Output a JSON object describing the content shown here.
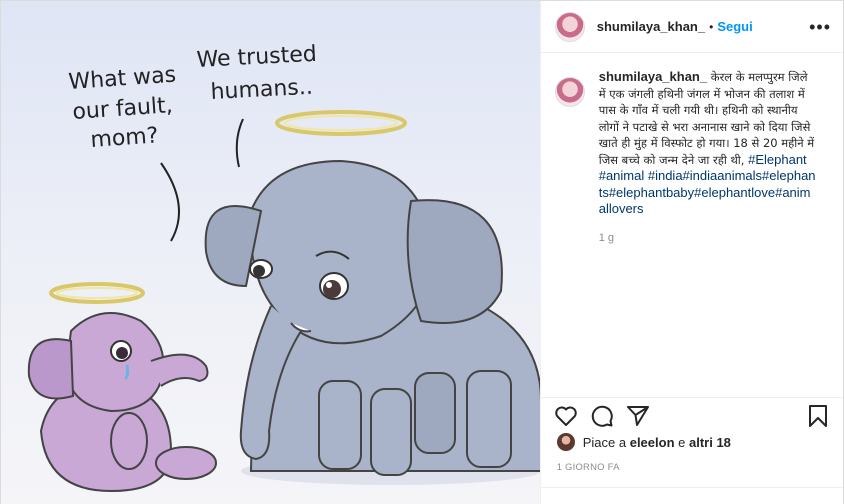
{
  "post": {
    "image": {
      "speech_left_lines": [
        "What was",
        "our fault,",
        "mom?"
      ],
      "speech_right_lines": [
        "We trusted",
        "humans.."
      ]
    },
    "header": {
      "username": "shumilaya_khan_",
      "separator": "•",
      "follow_label": "Segui",
      "more_label": "•••"
    },
    "caption": {
      "username": "shumilaya_khan_",
      "text": "केरल के मलप्पुरम जिले में एक जंगली हथिनी जंगल में भोजन की तलाश में पास के गाँव में चली गयी थी। हथिनी को स्थानीय लोगों ने पटाखे से भरा अनानास खाने को दिया जिसे खाते ही मुंह में विस्फोट हो गया। 18 से 20 महीने में जिस बच्चे को जन्म देने जा रही थी, ",
      "hashtags": "#Elephant #animal #india#indiaanimals#elephants#elephantbaby#elephantlove#animallovers",
      "age": "1 g"
    },
    "likes": {
      "prefix": "Piace a",
      "user": "eleelon",
      "connector": "e",
      "others": "altri 18"
    },
    "timestamp": "1 GIORNO FA",
    "icons": [
      "heart-icon",
      "comment-icon",
      "share-icon",
      "bookmark-icon"
    ],
    "colors": {
      "accent": "#0095f6",
      "hashtag": "#00376b",
      "muted": "#8e8e8e"
    }
  }
}
